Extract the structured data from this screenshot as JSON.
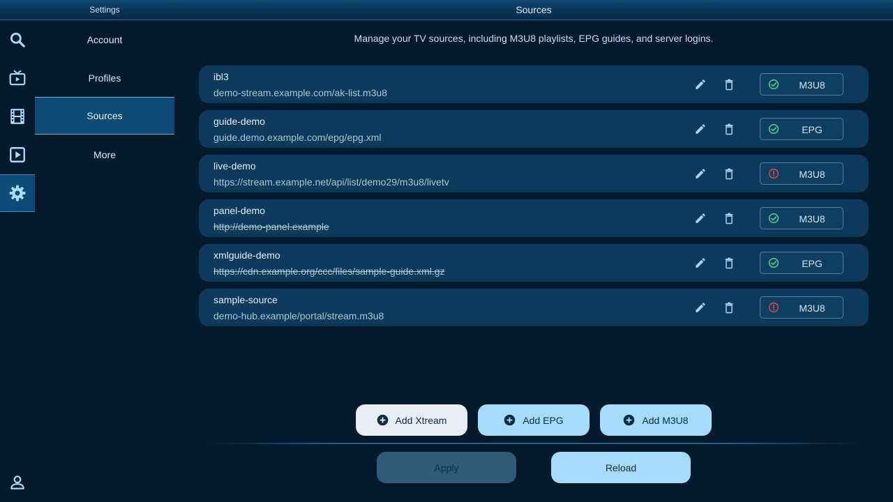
{
  "header": {
    "left_title": "Settings",
    "title": "Sources"
  },
  "rail": {
    "items": [
      "search-icon",
      "tv-icon",
      "film-icon",
      "play-icon",
      "gear-icon"
    ],
    "active": "gear-icon",
    "bottom": "profile-icon"
  },
  "menu": {
    "items": [
      {
        "label": "Account"
      },
      {
        "label": "Profiles"
      },
      {
        "label": "Sources"
      },
      {
        "label": "More"
      }
    ],
    "active_index": 2
  },
  "main": {
    "description": "Manage your TV sources, including M3U8 playlists, EPG guides, and server logins."
  },
  "sources": [
    {
      "name": "ibl3",
      "url": "demo-stream.example.com/ak-list.m3u8",
      "type": "M3U8",
      "status": "ok",
      "struck": false
    },
    {
      "name": "guide-demo",
      "url": "guide.demo.example.com/epg/epg.xml",
      "type": "EPG",
      "status": "ok",
      "struck": false
    },
    {
      "name": "live-demo",
      "url": "https://stream.example.net/api/list/demo29/m3u8/livetv",
      "type": "M3U8",
      "status": "error",
      "struck": false
    },
    {
      "name": "panel-demo",
      "url": "http://demo-panel.example",
      "type": "M3U8",
      "status": "ok",
      "struck": true
    },
    {
      "name": "xmlguide-demo",
      "url": "https://cdn.example.org/ccc/files/sample-guide.xml.gz",
      "type": "EPG",
      "status": "ok",
      "struck": true
    },
    {
      "name": "sample-source",
      "url": "demo-hub.example/portal/stream.m3u8",
      "type": "M3U8",
      "status": "error",
      "struck": false
    }
  ],
  "actions": {
    "add_xtream": "Add Xtream",
    "add_epg": "Add EPG",
    "add_m3u8": "Add M3U8",
    "apply": "Apply",
    "reload": "Reload"
  },
  "colors": {
    "background": "#03192c",
    "row": "#0b3a5c",
    "accent": "#a6dcfb",
    "ok": "#43d17e",
    "error": "#e24b4b"
  }
}
